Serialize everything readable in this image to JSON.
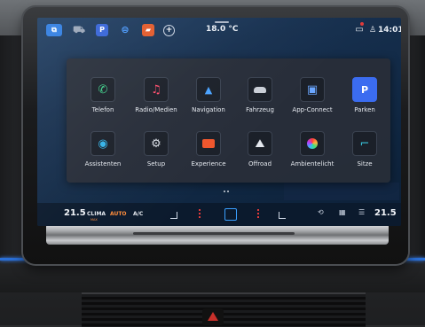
{
  "statusbar": {
    "temperature": "18.0 °C",
    "time": "14:01",
    "icons": [
      {
        "name": "assist-icon",
        "color": "#2f7de1"
      },
      {
        "name": "car-icon",
        "color": "#9aa6b8"
      },
      {
        "name": "parking-icon",
        "glyph": "P",
        "color": "#3563d8"
      },
      {
        "name": "drive-mode-icon",
        "color": "#e23b3b"
      },
      {
        "name": "mode-icon",
        "color": "#e25a2b"
      },
      {
        "name": "add-icon",
        "color": "#cfd8e6"
      }
    ]
  },
  "apps": [
    {
      "label": "Telefon",
      "icon": "phone-icon",
      "glyph": "✆",
      "color": "#3ed18a"
    },
    {
      "label": "Radio/Medien",
      "icon": "music-icon",
      "glyph": "♫",
      "color": "#ff4d6d"
    },
    {
      "label": "Navigation",
      "icon": "navigation-icon",
      "glyph": "▲",
      "color": "#4aa3ff"
    },
    {
      "label": "Fahrzeug",
      "icon": "vehicle-icon",
      "glyph": "🚘",
      "color": "#c9ced6"
    },
    {
      "label": "App-Connect",
      "icon": "app-connect-icon",
      "glyph": "▣",
      "color": "#6aa6ff"
    },
    {
      "label": "Parken",
      "icon": "parking-icon",
      "glyph": "P",
      "color": "#3b6cf0"
    },
    {
      "label": "Assistenten",
      "icon": "assistant-icon",
      "glyph": "◉",
      "color": "#34b3e8"
    },
    {
      "label": "Setup",
      "icon": "gear-icon",
      "glyph": "⚙",
      "color": "#d8dde5"
    },
    {
      "label": "Experience",
      "icon": "experience-icon",
      "glyph": "▰",
      "color": "#f0562c"
    },
    {
      "label": "Offroad",
      "icon": "mountain-icon",
      "glyph": "⛰",
      "color": "#e4e8ee"
    },
    {
      "label": "Ambientelicht",
      "icon": "ambient-light-icon",
      "glyph": "●",
      "color": "#e24fd0"
    },
    {
      "label": "Sitze",
      "icon": "seat-icon",
      "glyph": "⑂",
      "color": "#38c0d8"
    }
  ],
  "climate": {
    "left_temp": "21.5",
    "right_temp": "21.5",
    "clima_label": "CLIMA",
    "clima_sub": "MAX",
    "auto_label": "AUTO",
    "ac_label": "A/C"
  }
}
